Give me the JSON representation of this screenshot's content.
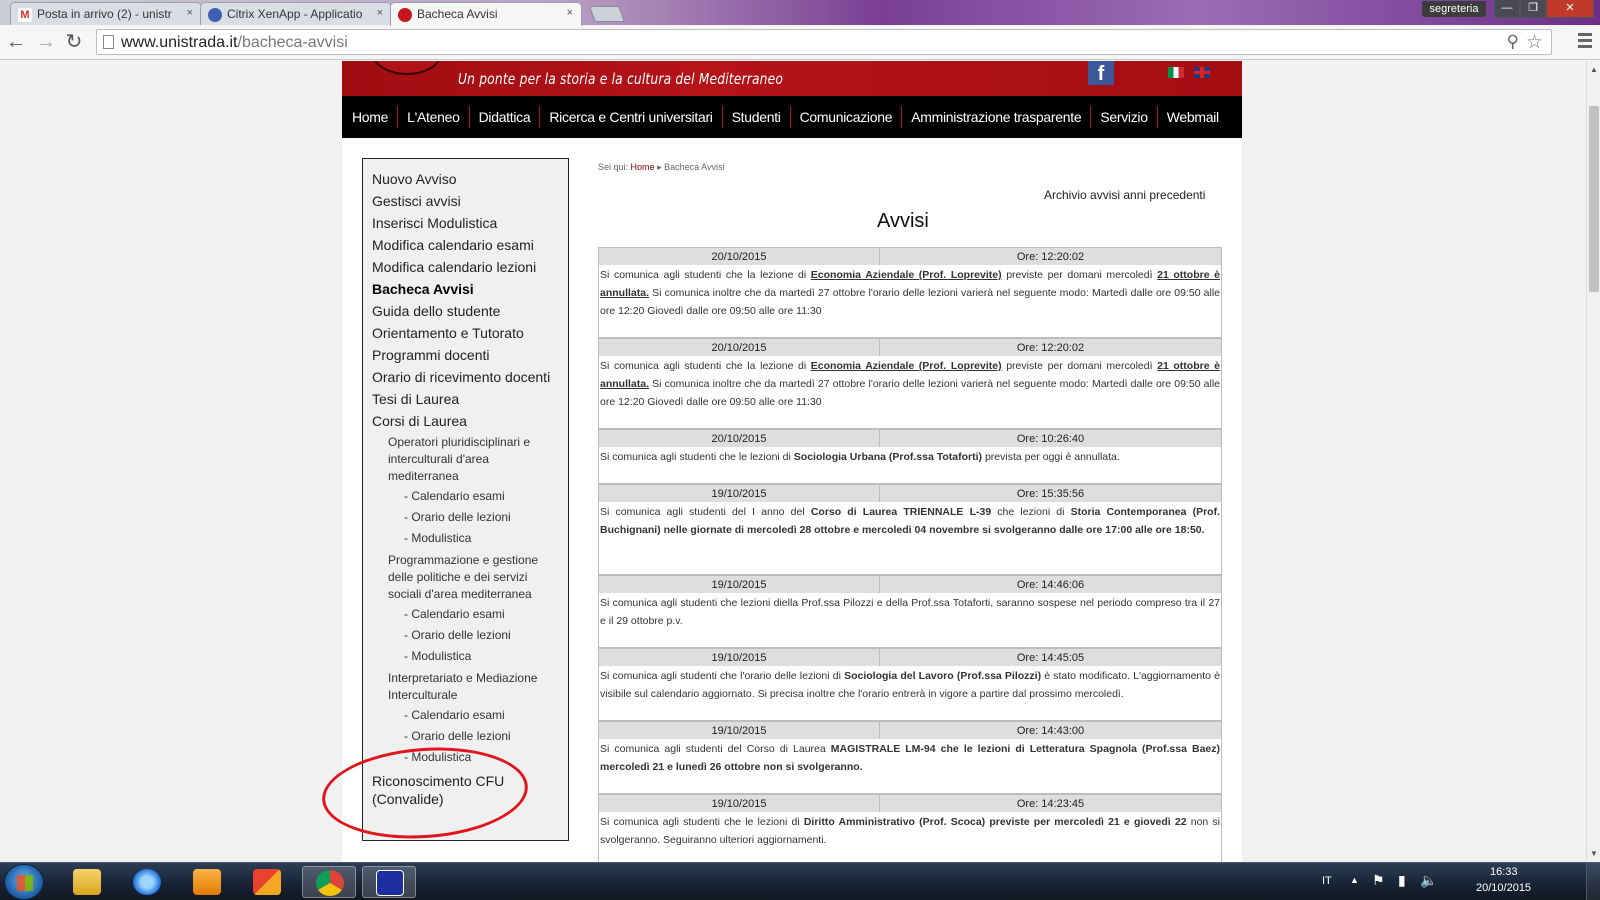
{
  "browser": {
    "tabs": [
      {
        "label": "Posta in arrivo (2) - unistr",
        "icon": "gmail-icon"
      },
      {
        "label": "Citrix XenApp - Applicatio",
        "icon": "citrix-icon"
      },
      {
        "label": "Bacheca Avvisi",
        "icon": "site-icon"
      }
    ],
    "close_glyph": "×",
    "user": "segreteria",
    "url_host": "www.unistrada.it",
    "url_path": "/bacheca-avvisi"
  },
  "site": {
    "tagline": "Un ponte per la storia e la cultura del Mediterraneo",
    "fb_glyph": "f",
    "nav": [
      "Home",
      "L'Ateneo",
      "Didattica",
      "Ricerca e Centri universitari",
      "Studenti",
      "Comunicazione",
      "Amministrazione trasparente",
      "Servizio",
      "Webmail"
    ]
  },
  "sidebar": {
    "top_items": [
      "Nuovo Avviso",
      "Gestisci avvisi",
      "Inserisci Modulistica",
      "Modifica calendario esami",
      "Modifica calendario lezioni",
      "Bacheca Avvisi",
      "Guida dello studente",
      "Orientamento e Tutorato",
      "Programmi docenti",
      "Orario di ricevimento docenti",
      "Tesi di Laurea",
      "Corsi di Laurea"
    ],
    "courses": [
      {
        "name": "Operatori pluridisciplinari e interculturali d'area mediterranea",
        "sub": [
          "- Calendario esami",
          "- Orario delle lezioni",
          "- Modulistica"
        ]
      },
      {
        "name": "Programmazione e gestione delle politiche e dei servizi sociali d'area mediterranea",
        "sub": [
          "- Calendario esami",
          "- Orario delle lezioni",
          "- Modulistica"
        ]
      },
      {
        "name": "Interpretariato e Mediazione Interculturale",
        "sub": [
          "- Calendario esami",
          "- Orario delle lezioni",
          "- Modulistica"
        ]
      }
    ],
    "last_item": "Riconoscimento CFU (Convalide)"
  },
  "content": {
    "breadcrumb_prefix": "Sei qui:",
    "breadcrumb_home": "Home",
    "breadcrumb_sep": "▸",
    "breadcrumb_current": "Bacheca Avvisi",
    "archive_link": "Archivio avvisi anni precedenti",
    "title": "Avvisi",
    "notices": [
      {
        "date": "20/10/2015",
        "time": "Ore: 12:20:02",
        "body": [
          {
            "t": "Si comunica agli studenti che la lezione di "
          },
          {
            "t": "Economia Aziendale (Prof. Loprevite)",
            "s": "u"
          },
          {
            "t": " previste per domani mercoledì "
          },
          {
            "t": "21 ottobre è annullata.",
            "s": "u"
          },
          {
            "t": " Si comunica inoltre che da martedì 27 ottobre l'orario delle lezioni varierà nel seguente modo: Martedì dalle ore 09:50 alle ore 12:20 Giovedì dalle ore 09:50 alle ore 11:30"
          }
        ]
      },
      {
        "date": "20/10/2015",
        "time": "Ore: 12:20:02",
        "body": [
          {
            "t": "Si comunica agli studenti che la lezione di "
          },
          {
            "t": "Economia Aziendale (Prof. Loprevite)",
            "s": "u"
          },
          {
            "t": " previste per domani mercoledì "
          },
          {
            "t": "21 ottobre è annullata.",
            "s": "u"
          },
          {
            "t": " Si comunica inoltre che da martedì 27 ottobre l'orario delle lezioni varierà nel seguente modo: Martedì dalle ore 09:50 alle ore 12:20 Giovedì dalle ore 09:50 alle ore 11:30"
          }
        ]
      },
      {
        "date": "20/10/2015",
        "time": "Ore: 10:26:40",
        "body": [
          {
            "t": "Si comunica agli studenti che le lezioni di "
          },
          {
            "t": "Sociologia Urbana (Prof.ssa Totaforti)",
            "s": "b"
          },
          {
            "t": "  prevista per oggi  è annullata."
          }
        ]
      },
      {
        "date": "19/10/2015",
        "time": "Ore: 15:35:56",
        "body": [
          {
            "t": "Si comunica agli studenti del I anno del "
          },
          {
            "t": "Corso di Laurea TRIENNALE  L-39",
            "s": "b"
          },
          {
            "t": " che lezioni di "
          },
          {
            "t": "Storia Contemporanea (Prof. Buchignani) nelle giornate di mercoledì 28 ottobre e mercoledì 04 novembre si svolgeranno dalle ore 17:00 alle ore 18:50.",
            "s": "b"
          }
        ]
      },
      {
        "date": "19/10/2015",
        "time": "Ore: 14:46:06",
        "body": [
          {
            "t": "Si comunica agli studenti che lezioni diella Prof.ssa Pilozzi e della Prof.ssa Totaforti, saranno sospese nel periodo compreso tra il 27 e il 29 ottobre p.v."
          }
        ]
      },
      {
        "date": "19/10/2015",
        "time": "Ore: 14:45:05",
        "body": [
          {
            "t": "Si comunica agli studenti che l'orario delle lezioni di "
          },
          {
            "t": "Sociologia del Lavoro (Prof.ssa Pilozzi)",
            "s": "b"
          },
          {
            "t": " è stato modificato. L'aggiornamento è visibile sul calendario aggiornato. Si precisa inoltre che l'orario entrerà in vigore a partire dal prossimo mercoledì."
          }
        ]
      },
      {
        "date": "19/10/2015",
        "time": "Ore: 14:43:00",
        "body": [
          {
            "t": "Si comunica agli studenti del Corso di Laurea "
          },
          {
            "t": "MAGISTRALE LM-94 che le lezioni di Letteratura Spagnola (Prof.ssa Baez)  mercoledì 21 e lunedì 26 ottobre non si svolgeranno.",
            "s": "b"
          }
        ]
      },
      {
        "date": "19/10/2015",
        "time": "Ore: 14:23:45",
        "body": [
          {
            "t": "Si comunica agli studenti che le lezioni di "
          },
          {
            "t": "Diritto Amministrativo (Prof. Scoca) previste per mercoledì 21 e giovedì 22",
            "s": "b"
          },
          {
            "t": " non si svolgeranno. Seguiranno ulteriori aggiornamenti."
          }
        ]
      }
    ]
  },
  "taskbar": {
    "lang": "IT",
    "time": "16:33",
    "date": "20/10/2015",
    "apps": [
      "explorer-icon",
      "internet-explorer-icon",
      "media-player-icon",
      "office-icon",
      "chrome-icon",
      "citrix-receiver-icon"
    ]
  }
}
